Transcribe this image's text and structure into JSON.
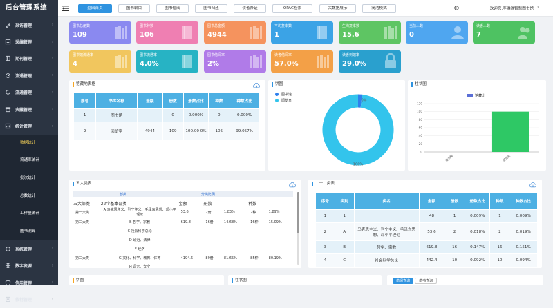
{
  "app": {
    "title": "后台管理系统"
  },
  "sidebar": {
    "items": [
      {
        "label": "采访管理",
        "icon": "pen-icon"
      },
      {
        "label": "采编管理",
        "icon": "catalog-icon"
      },
      {
        "label": "期刊管理",
        "icon": "journal-icon"
      },
      {
        "label": "流通管理",
        "icon": "circulation-icon"
      },
      {
        "label": "流通管理",
        "icon": "refresh-icon"
      },
      {
        "label": "典藏管理",
        "icon": "archive-icon"
      },
      {
        "label": "统计管理",
        "icon": "stats-icon"
      }
    ],
    "sub_items": [
      {
        "label": "数据统计",
        "active": true
      },
      {
        "label": "流通率统计"
      },
      {
        "label": "批次统计"
      },
      {
        "label": "总数统计"
      },
      {
        "label": "工作量统计"
      },
      {
        "label": "图书测算"
      }
    ],
    "bottom_items": [
      {
        "label": "系统管理",
        "icon": "system-icon"
      },
      {
        "label": "数字资源",
        "icon": "digital-icon"
      },
      {
        "label": "信用管理",
        "icon": "credit-icon"
      },
      {
        "label": "教材管理",
        "icon": "textbook-icon"
      }
    ]
  },
  "header": {
    "tabs": [
      {
        "label": "返回首页",
        "active": true
      },
      {
        "label": "图书编目"
      },
      {
        "label": "图书借阅"
      },
      {
        "label": "图书归还"
      },
      {
        "label": "读者办证"
      },
      {
        "label": "OPAC检索"
      },
      {
        "label": "大数据展示"
      },
      {
        "label": "简洁模式"
      }
    ],
    "welcome": "欢迎您,李琳得智慧图书馆"
  },
  "stats": [
    {
      "label": "图书总册数",
      "value": "109",
      "color": "#8a89f0",
      "icon": "books-icon"
    },
    {
      "label": "图书种数",
      "value": "106",
      "color": "#ef7fb2",
      "icon": "book-icon"
    },
    {
      "label": "图书总金额",
      "value": "4944",
      "color": "#f5935e",
      "icon": "books-icon"
    },
    {
      "label": "平均复本数",
      "value": "1",
      "color": "#3ba3e6",
      "icon": "book-icon"
    },
    {
      "label": "生均复本数",
      "value": "15.6",
      "color": "#5ec563",
      "icon": "books-icon"
    },
    {
      "label": "当前人数",
      "value": "0",
      "color": "#4fa6f0",
      "icon": "user-icon"
    },
    {
      "label": "读者人数",
      "value": "7",
      "color": "#4ec262",
      "icon": "users-icon"
    },
    {
      "label": "图书馆流通率",
      "value": "4",
      "color": "#f1c65e",
      "icon": "books-icon"
    },
    {
      "label": "图书流通率",
      "value": "4.0%",
      "color": "#27b3c4",
      "icon": "book-icon"
    },
    {
      "label": "图书借阅率",
      "value": "2%",
      "color": "#b07be8",
      "icon": "books-icon"
    },
    {
      "label": "读者借阅率",
      "value": "57.0%",
      "color": "#f3a047",
      "icon": "books-icon"
    },
    {
      "label": "读者到馆率",
      "value": "29.0%",
      "color": "#2aa0ce",
      "icon": "lock-icon"
    }
  ],
  "collection_table": {
    "title": "馆藏地表格",
    "headers": [
      "序号",
      "书库名称",
      "金额",
      "册数",
      "册数占比",
      "种数",
      "种数占比"
    ],
    "rows": [
      [
        "1",
        "图书馆",
        "",
        "0",
        "0.000%",
        "0",
        "0.000%"
      ],
      [
        "2",
        "阅览室",
        "4944",
        "109",
        "100.00 0%",
        "105",
        "99.057%"
      ]
    ]
  },
  "pie": {
    "title": "饼图",
    "legend": [
      "图书馆",
      "阅览室"
    ],
    "colors": [
      "#2f80ed",
      "#33c4ec"
    ],
    "label_big": "100%",
    "label_small": "0%"
  },
  "chart_data": [
    {
      "type": "pie",
      "title": "饼图",
      "categories": [
        "图书馆",
        "阅览室"
      ],
      "values": [
        0,
        100
      ]
    },
    {
      "type": "bar",
      "title": "柱状图",
      "categories": [
        "图书馆",
        "阅览室"
      ],
      "series": [
        {
          "name": "馆藏比",
          "values": [
            0,
            100
          ]
        }
      ],
      "ylim": [
        0,
        120
      ],
      "yticks": [
        0,
        20,
        40,
        60,
        80,
        100,
        120
      ]
    }
  ],
  "bar": {
    "title": "柱状图",
    "legend": "馆藏比",
    "bar_color": "#2ec865",
    "legend_color": "#5b6fd6"
  },
  "five": {
    "title": "五大类表",
    "group_headers": [
      "部类",
      "分类比例"
    ],
    "col_headers": [
      "22个基本部类",
      "金额",
      "册数",
      "种数"
    ],
    "rows": [
      [
        "第一大类",
        "A 马克思主义、列宁主义、毛泽东思想、邓小平理论",
        "53.6",
        "2册",
        "1.83%",
        "2种",
        "1.89%"
      ],
      [
        "第二大类",
        "B 哲学、宗教",
        "619.8",
        "16册",
        "14.68%",
        "16种",
        "15.09%"
      ],
      [
        "",
        "C 社会科学总论",
        "",
        "",
        "",
        "",
        ""
      ],
      [
        "",
        "D 政治、法律",
        "",
        "",
        "",
        "",
        ""
      ],
      [
        "",
        "F 经济",
        "",
        "",
        "",
        "",
        ""
      ],
      [
        "第三大类",
        "G 文化、科学、教育、体育",
        "4194.6",
        "89册",
        "81.65%",
        "85种",
        "80.19%"
      ],
      [
        "",
        "H 语言、文字",
        "",
        "",
        "",
        "",
        ""
      ]
    ],
    "first_col": "五大部类"
  },
  "twentytwo": {
    "title": "二十二类表",
    "headers": [
      "序号",
      "类别",
      "类名",
      "金额",
      "册数",
      "册数占比",
      "种数",
      "种数占比"
    ],
    "rows": [
      [
        "1",
        "1",
        "",
        "48",
        "1",
        "0.009%",
        "1",
        "0.009%"
      ],
      [
        "2",
        "A",
        "马克思主义、列宁主义、毛泽东思想、邓小平理论",
        "53.6",
        "2",
        "0.018%",
        "2",
        "0.019%"
      ],
      [
        "3",
        "B",
        "哲学、宗教",
        "619.8",
        "16",
        "0.147%",
        "16",
        "0.151%"
      ],
      [
        "4",
        "C",
        "社会科学总论",
        "442.4",
        "10",
        "0.092%",
        "10",
        "0.094%"
      ]
    ]
  },
  "bottom": {
    "pie_title": "饼图",
    "bar_title": "柱状图",
    "tab1": "借阅查询",
    "tab2": "借书查询"
  }
}
